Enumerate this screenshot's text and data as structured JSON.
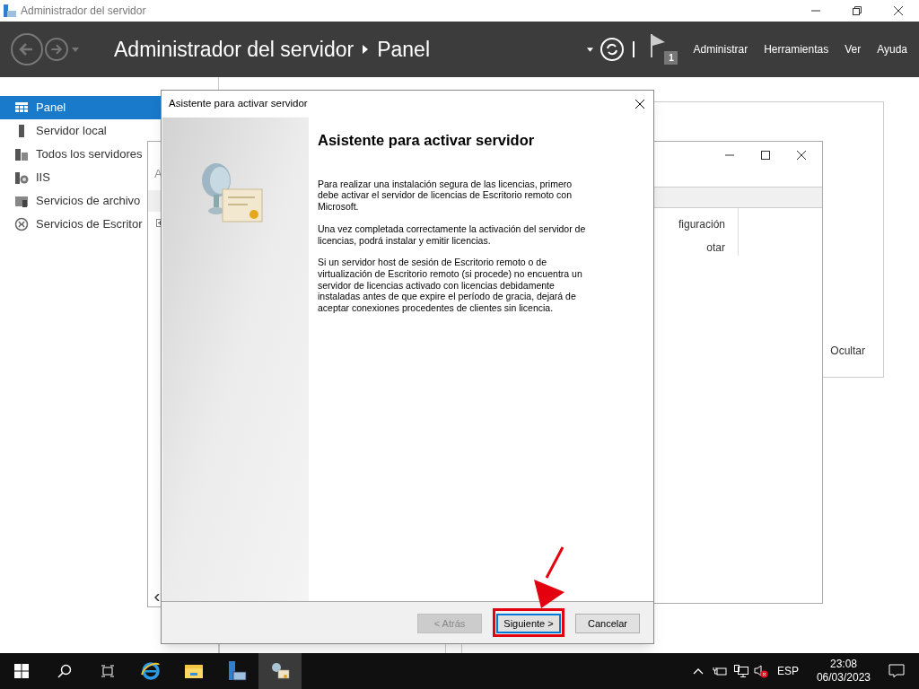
{
  "window": {
    "title": "Administrador del servidor"
  },
  "header": {
    "breadcrumb": [
      "Administrador del servidor",
      "Panel"
    ],
    "flag_count": "1",
    "menu": [
      "Administrar",
      "Herramientas",
      "Ver",
      "Ayuda"
    ]
  },
  "sidebar": {
    "items": [
      {
        "label": "Panel",
        "selected": true
      },
      {
        "label": "Servidor local",
        "selected": false
      },
      {
        "label": "Todos los servidores",
        "selected": false
      },
      {
        "label": "IIS",
        "selected": false
      },
      {
        "label": "Servicios de archivo",
        "selected": false
      },
      {
        "label": "Servicios de Escritor",
        "selected": false
      }
    ]
  },
  "background": {
    "left_window_letter": "A",
    "right_window_items": [
      "figuración",
      "otar"
    ],
    "panel_button": "Ocultar"
  },
  "dialog": {
    "title": "Asistente para activar servidor",
    "heading": "Asistente para activar servidor",
    "paragraphs": [
      "Para realizar una instalación segura de las licencias, primero debe activar el servidor de licencias de Escritorio remoto con Microsoft.",
      "Una vez completada correctamente la activación del servidor de licencias, podrá instalar y emitir licencias.",
      "Si un servidor host de sesión de Escritorio remoto o de virtualización de Escritorio remoto (si procede) no encuentra un servidor de licencias activado con licencias debidamente instaladas antes de que expire el período de gracia, dejará de aceptar conexiones procedentes de clientes sin licencia."
    ],
    "buttons": [
      {
        "label": "< Atrás",
        "disabled": true,
        "focused": false,
        "highlighted": false
      },
      {
        "label": "Siguiente >",
        "disabled": false,
        "focused": true,
        "highlighted": true
      },
      {
        "label": "Cancelar",
        "disabled": false,
        "focused": false,
        "highlighted": false
      }
    ]
  },
  "taskbar": {
    "apps": [
      {
        "kind": "ie",
        "selected": false
      },
      {
        "kind": "explorer",
        "selected": false
      },
      {
        "kind": "server",
        "selected": false
      },
      {
        "kind": "license",
        "selected": true
      }
    ],
    "language": "ESP",
    "time": "23:08",
    "date": "06/03/2023"
  }
}
